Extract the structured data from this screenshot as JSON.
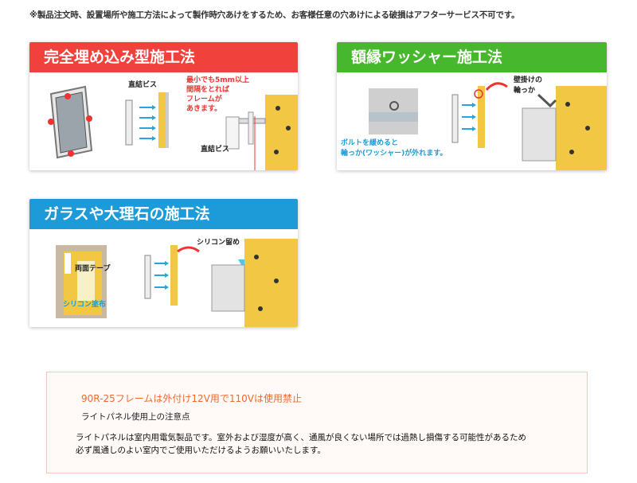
{
  "notice": "※製品注文時、設置場所や施工方法によって製作時穴あけをするため、お客様任意の穴あけによる破損はアフターサービス不可です。",
  "methods": {
    "flush": {
      "title": "完全埋め込み型施工法",
      "color": "#f0413c",
      "label_screw_top": "直結ビス",
      "label_gap_1": "最小でも5mm以上",
      "label_gap_2": "間隔をとれば",
      "label_gap_3": "フレームが",
      "label_gap_4": "あきます。",
      "label_screw_bottom": "直結ビス"
    },
    "washer": {
      "title": "額縁ワッシャー施工法",
      "color": "#47b72e",
      "label_hook_1": "壁掛けの",
      "label_hook_2": "輪っか",
      "label_bolt_1": "ボルトを緩めると",
      "label_bolt_2": "輪っか(ワッシャー)が外れます。"
    },
    "glass": {
      "title": "ガラスや大理石の施工法",
      "color": "#1d9bd8",
      "label_silicone_seal": "シリコン留め",
      "label_tape": "両面テープ",
      "label_silicone_apply": "シリコン塗布"
    }
  },
  "warning": {
    "title": "90R-25フレームは外付け12V用で110Vは使用禁止",
    "subtitle": "ライトパネル使用上の注意点",
    "line1": "ライトパネルは室内用電気製品です。室外および湿度が高く、通風が良くない場所では過熱し損傷する可能性があるため",
    "line2": "必ず風通しのよい室内でご使用いただけるようお願いいたします。"
  }
}
